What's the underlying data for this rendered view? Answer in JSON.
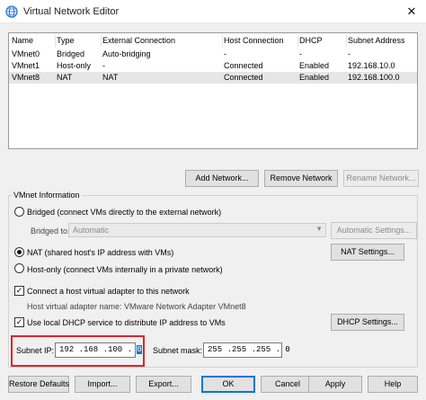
{
  "window": {
    "title": "Virtual Network Editor",
    "close_glyph": "✕"
  },
  "table": {
    "columns": [
      "Name",
      "Type",
      "External Connection",
      "Host Connection",
      "DHCP",
      "Subnet Address"
    ],
    "rows": [
      [
        "VMnet0",
        "Bridged",
        "Auto-bridging",
        "-",
        "-",
        "-"
      ],
      [
        "VMnet1",
        "Host-only",
        "-",
        "Connected",
        "Enabled",
        "192.168.10.0"
      ],
      [
        "VMnet8",
        "NAT",
        "NAT",
        "Connected",
        "Enabled",
        "192.168.100.0"
      ]
    ],
    "selected_row": 2
  },
  "table_buttons": {
    "add": "Add Network...",
    "remove": "Remove Network",
    "rename": "Rename Network..."
  },
  "vmnet_info": {
    "legend": "VMnet Information",
    "bridged_label": "Bridged (connect VMs directly to the external network)",
    "bridged_to_label": "Bridged to:",
    "bridged_to_value": "Automatic",
    "automatic_settings": "Automatic Settings...",
    "nat_label": "NAT (shared host's IP address with VMs)",
    "nat_settings": "NAT Settings...",
    "hostonly_label": "Host-only (connect VMs internally in a private network)",
    "selected_mode": "nat",
    "connect_adapter_label": "Connect a host virtual adapter to this network",
    "connect_adapter_checked": true,
    "adapter_name_text": "Host virtual adapter name: VMware Network Adapter VMnet8",
    "dhcp_label": "Use local DHCP service to distribute IP address to VMs",
    "dhcp_checked": true,
    "dhcp_settings": "DHCP Settings...",
    "subnet_ip_label": "Subnet IP:",
    "subnet_ip_prefix": "192 .168 .100 . ",
    "subnet_ip_selected": "0",
    "subnet_mask_label": "Subnet mask:",
    "subnet_mask_value": "255 .255 .255 . 0"
  },
  "footer_buttons": {
    "restore": "Restore Defaults",
    "import": "Import...",
    "export": "Export...",
    "ok": "OK",
    "cancel": "Cancel",
    "apply": "Apply",
    "help": "Help"
  },
  "colors": {
    "accent": "#0078d7",
    "highlight_box": "#d62828",
    "selected_row": "#e6e6e6",
    "icon_blue": "#2b7bd6"
  },
  "icons": {
    "title": "network-globe-icon",
    "close": "close-icon",
    "dropdown": "chevron-down-icon"
  }
}
